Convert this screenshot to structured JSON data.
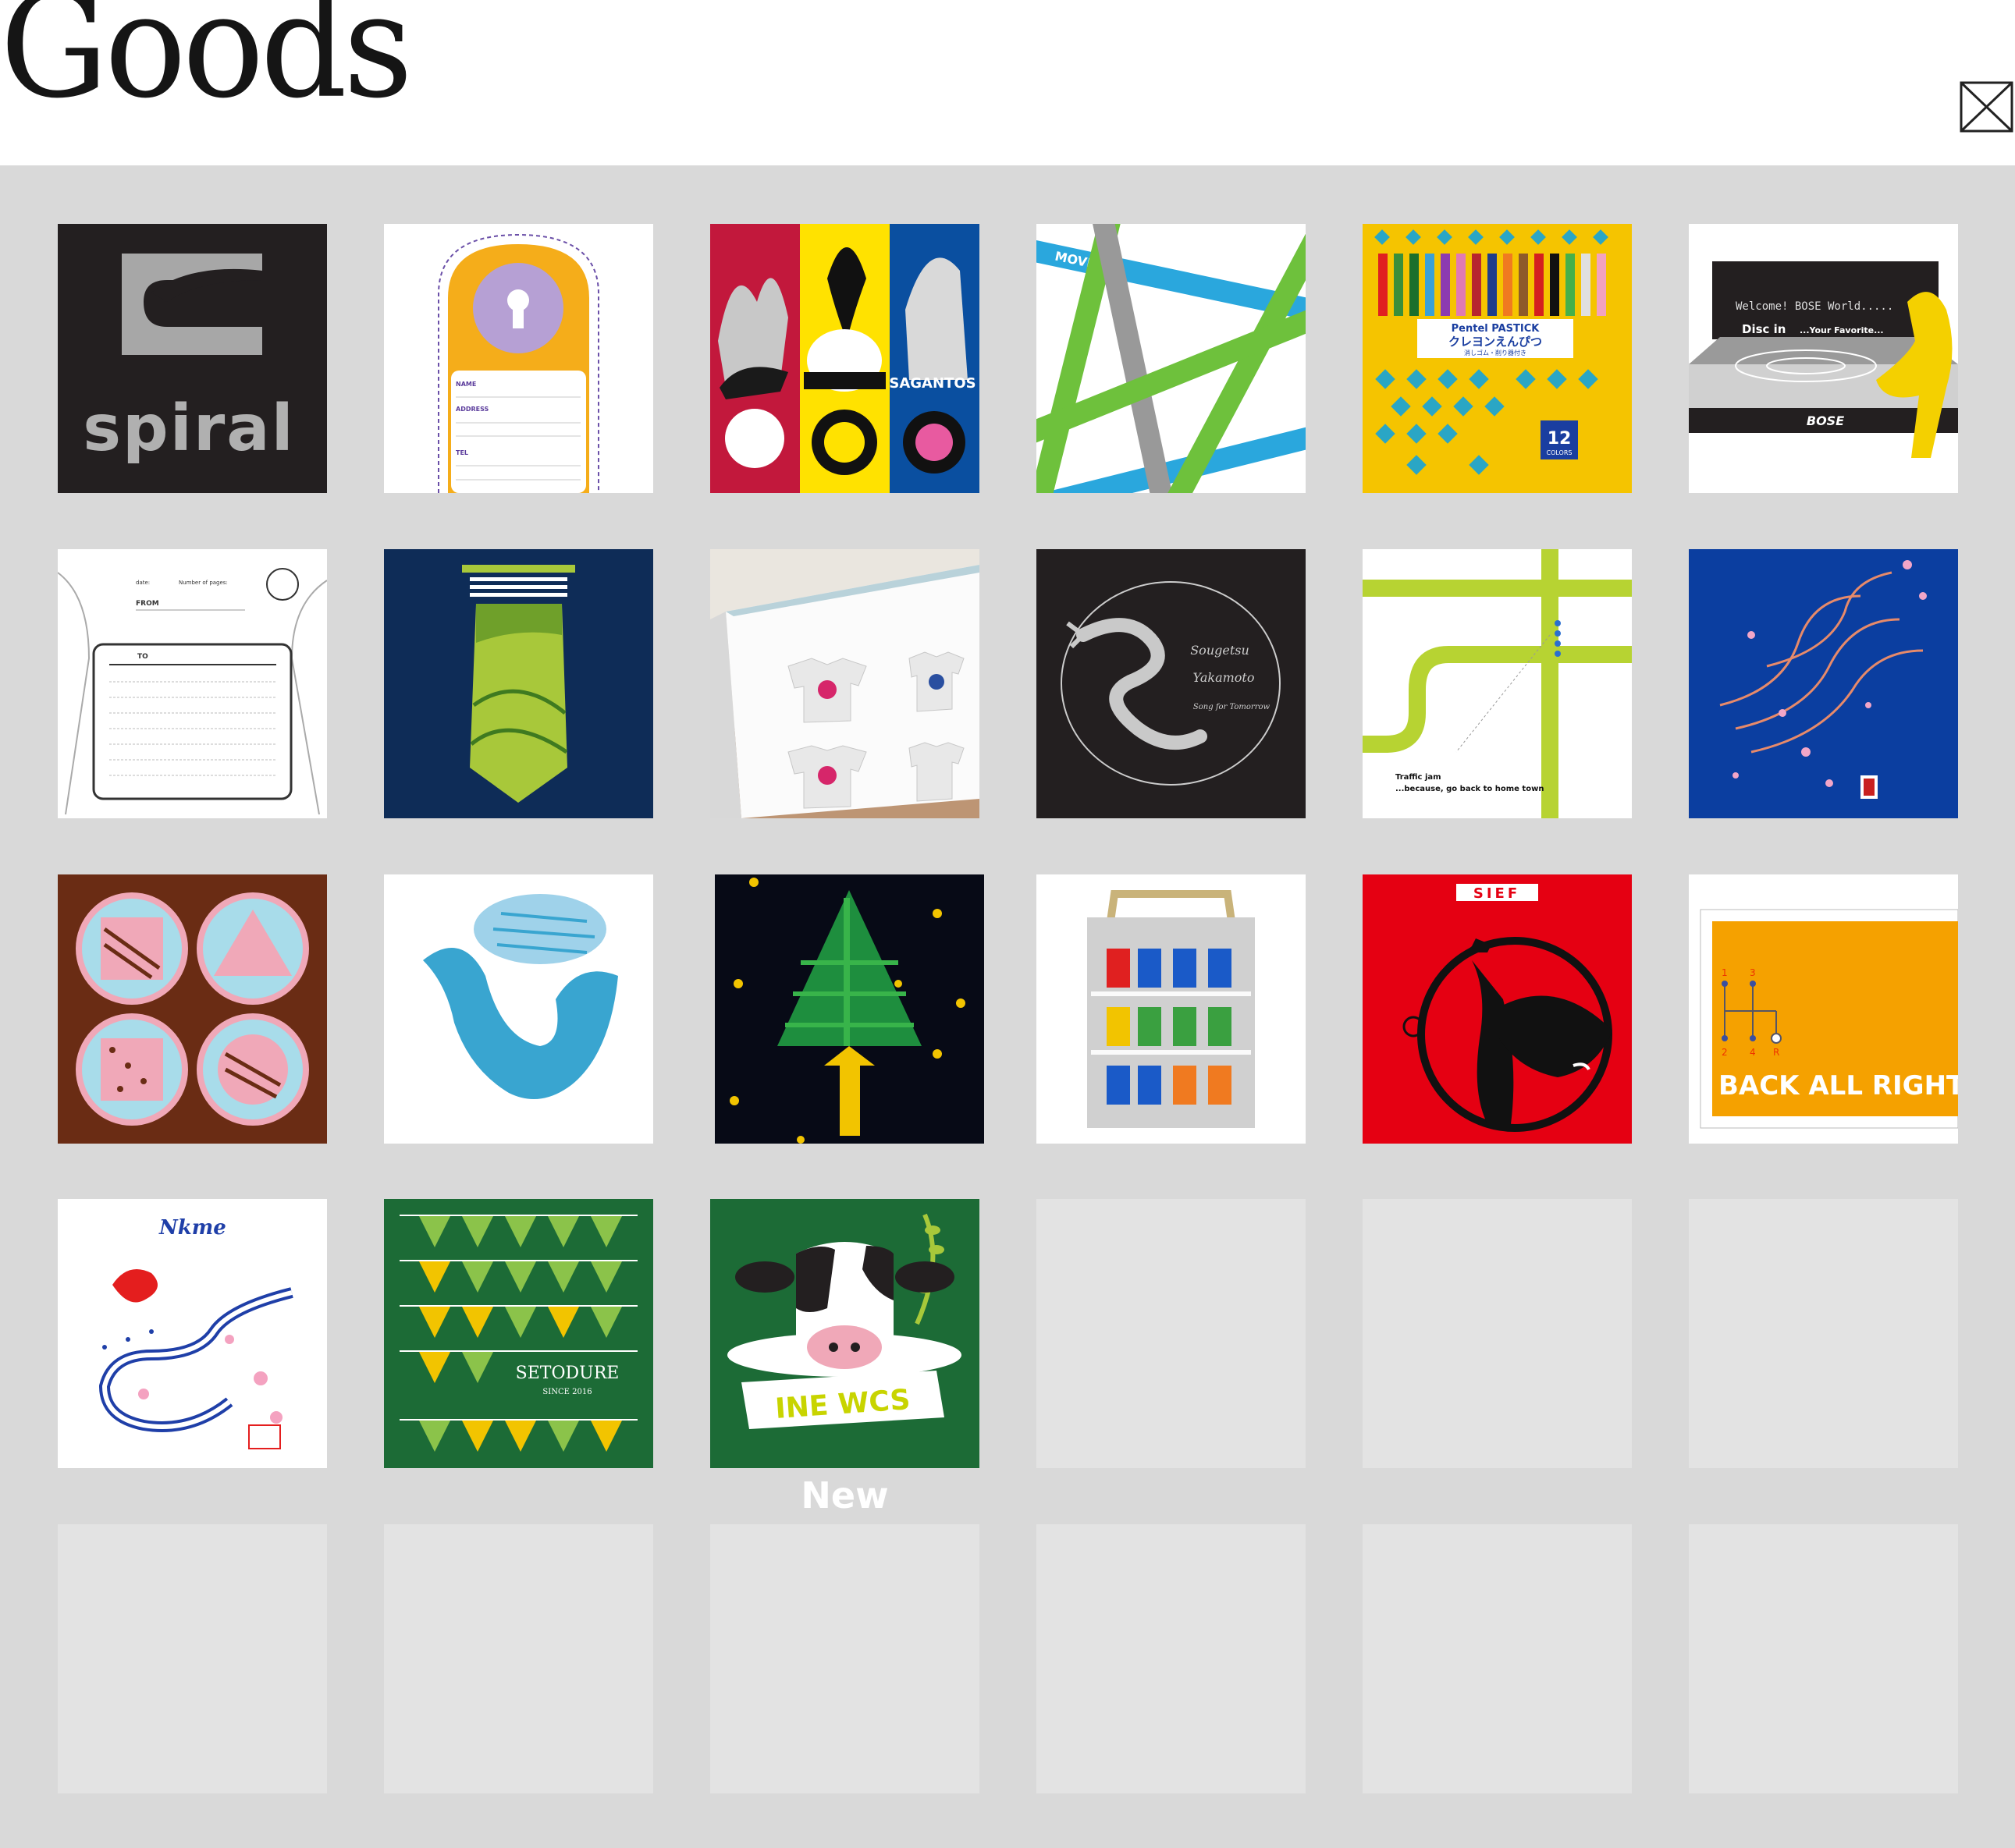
{
  "header": {
    "title": "Goods"
  },
  "icons": {
    "close": "close-icon"
  },
  "colors": {
    "background": "#d9d9d9",
    "empty_tile": "#e3e3e3",
    "caption": "#ffffff"
  },
  "tiles": [
    {
      "text": [
        "spiral"
      ]
    },
    {
      "text": [
        "NAME",
        "ADDRESS",
        "TEL"
      ]
    },
    {
      "text": [
        "SAGANTOS"
      ]
    },
    {
      "text": [
        "MOVING!"
      ]
    },
    {
      "text": [
        "Pentel PASTICK",
        "クレヨンえんぴつ",
        "消しゴム・削り器付き",
        "12",
        "COLORS"
      ]
    },
    {
      "text": [
        "Welcome! BOSE World.....",
        "Disc in",
        "...Your Favorite...",
        "BOSE"
      ]
    },
    {
      "text": [
        "date:",
        "Number of pages:",
        "FROM",
        "TO"
      ]
    },
    {
      "text": []
    },
    {
      "text": []
    },
    {
      "text": [
        "Sougetsu",
        "Yakamoto",
        "Song for Tomorrow"
      ]
    },
    {
      "text": [
        "Traffic jam",
        "...because, go back to home town"
      ]
    },
    {
      "text": []
    },
    {
      "text": []
    },
    {
      "text": []
    },
    {
      "text": []
    },
    {
      "text": []
    },
    {
      "text": [
        "SIEF"
      ]
    },
    {
      "text": [
        "1",
        "3",
        "2",
        "4",
        "R",
        "BACK ALL RIGHT!"
      ]
    },
    {
      "text": [
        "Nkme"
      ]
    },
    {
      "text": [
        "SETODURE",
        "SINCE 2016"
      ]
    },
    {
      "text": [
        "INE WCS"
      ],
      "caption": "New"
    }
  ]
}
